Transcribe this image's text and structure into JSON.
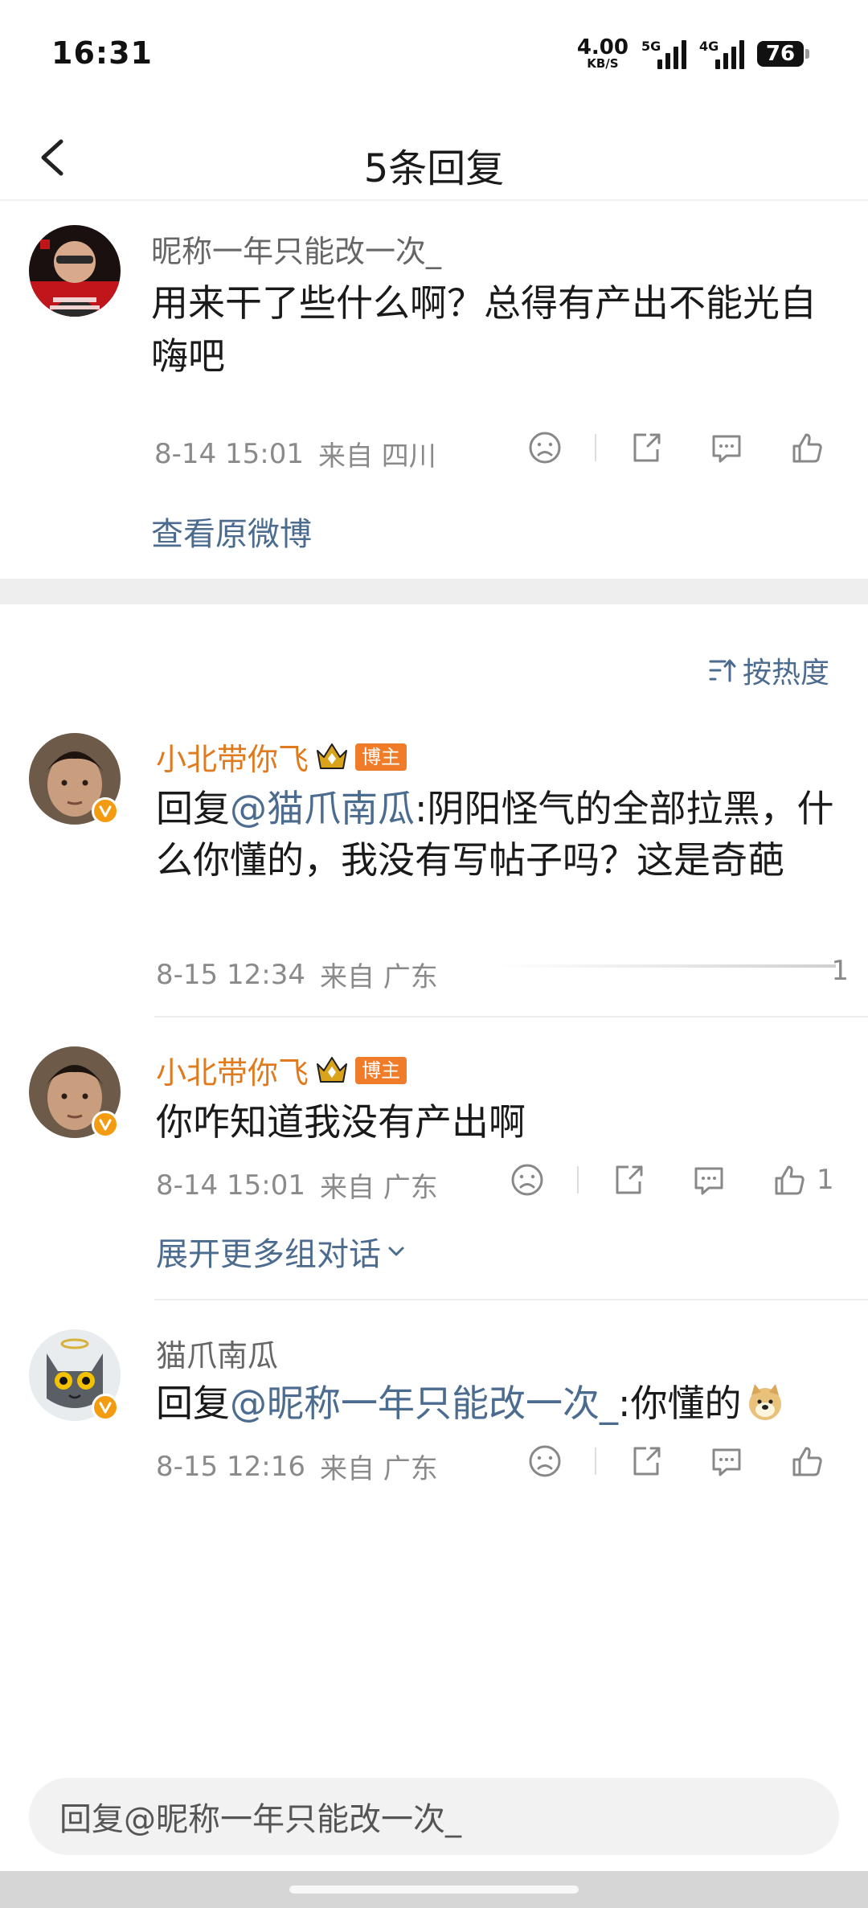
{
  "status_bar": {
    "time": "16:31",
    "net_speed": "4.00",
    "net_unit": "KB/S",
    "signal_1_tag": "5G",
    "signal_2_tag": "4G",
    "battery": "76"
  },
  "nav": {
    "title": "5条回复",
    "back_icon": "chevron-left-icon"
  },
  "original_comment": {
    "username": "昵称一年只能改一次_",
    "content": "用来干了些什么啊？总得有产出不能光自嗨吧",
    "time": "8-14 15:01",
    "from": "来自 四川",
    "view_original": "查看原微博"
  },
  "sort": {
    "label": "按热度",
    "icon": "sort-icon"
  },
  "replies": [
    {
      "username": "小北带你飞",
      "badge": "博主",
      "prefix": "回复",
      "mention": "@猫爪南瓜",
      "text": ":阴阳怪气的全部拉黑，什么你懂的，我没有写帖子吗？这是奇葩",
      "time": "8-15 12:34",
      "from": "来自 广东",
      "likes": "1"
    },
    {
      "username": "小北带你飞",
      "badge": "博主",
      "text": "你咋知道我没有产出啊",
      "time": "8-14 15:01",
      "from": "来自 广东",
      "likes": "1",
      "expand": "展开更多组对话"
    },
    {
      "username": "猫爪南瓜",
      "prefix": "回复",
      "mention": "@昵称一年只能改一次_",
      "text": ":你懂的",
      "time": "8-15 12:16",
      "from": "来自 广东"
    }
  ],
  "input": {
    "placeholder": "回复@昵称一年只能改一次_"
  },
  "colors": {
    "link": "#4b6b8f",
    "username_orange": "#e07a1d",
    "badge_orange": "#f07c2a"
  }
}
